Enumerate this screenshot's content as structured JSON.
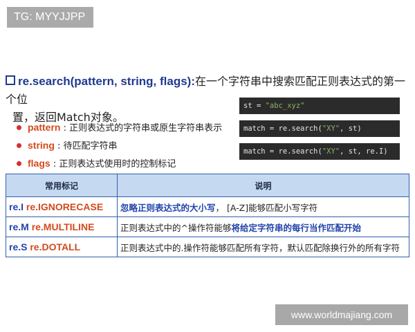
{
  "corner_tag": "TG: MYYJJPP",
  "heading": {
    "function_sig": "re.search(pattern, string, flags):",
    "desc_line1": "在一个字符串中搜索匹配正则表达式的第一个位",
    "desc_line2": "置，返回Match对象。"
  },
  "params": [
    {
      "name": "pattern",
      "desc": " : 正则表达式的字符串或原生字符串表示"
    },
    {
      "name": "string",
      "desc": " : 待匹配字符串"
    },
    {
      "name": "flags",
      "desc": " : 正则表达式使用时的控制标记"
    }
  ],
  "code_snippets": [
    {
      "pre": "st = ",
      "str": "\"abc_xyz\"",
      "post": ""
    },
    {
      "pre": "match = re.search(",
      "str": "\"XY\"",
      "post": ", st)"
    },
    {
      "pre": "match = re.search(",
      "str": "\"XY\"",
      "post": ", st, re.I)"
    }
  ],
  "table": {
    "headers": [
      "常用标记",
      "说明"
    ],
    "rows": [
      {
        "short": "re.I",
        "full": "re.IGNORECASE",
        "desc_a": "忽略正则表达式的大小写",
        "desc_b": "，  [A-Z]能够匹配小写字符",
        "highlight_first": true
      },
      {
        "short": "re.M",
        "full": "re.MULTILINE",
        "desc_a": "正则表达式中的^操作符能够",
        "desc_b": "将给定字符串的每行当作匹配开始",
        "highlight_first": false
      },
      {
        "short": "re.S",
        "full": "re.DOTALL",
        "desc_a": "正则表达式中的.操作符能够匹配所有字符，默认匹配除换行外的所有字符",
        "desc_b": "",
        "highlight_first": false
      }
    ]
  },
  "watermark": "www.worldmajiang.com",
  "colors": {
    "accent_blue": "#2244aa",
    "accent_orange": "#d24a1c",
    "header_bg": "#c5d9f1",
    "code_bg": "#2b2b2b"
  }
}
